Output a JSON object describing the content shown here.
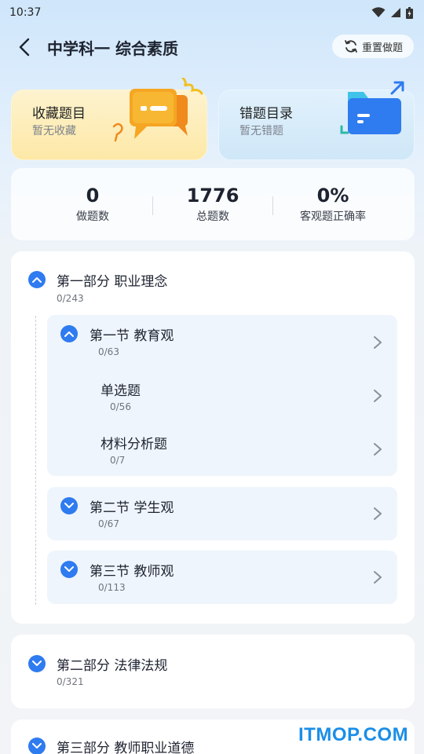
{
  "status_bar": {
    "time": "10:37"
  },
  "header": {
    "title": "中学科一 综合素质",
    "reset_label": "重置做题"
  },
  "cards": {
    "favorites": {
      "title": "收藏题目",
      "subtitle": "暂无收藏"
    },
    "wrong": {
      "title": "错题目录",
      "subtitle": "暂无错题"
    }
  },
  "stats": [
    {
      "value": "0",
      "label": "做题数"
    },
    {
      "value": "1776",
      "label": "总题数"
    },
    {
      "value": "0%",
      "label": "客观题正确率"
    }
  ],
  "parts": [
    {
      "title": "第一部分 职业理念",
      "count": "0/243",
      "expanded": true,
      "sections": [
        {
          "title": "第一节 教育观",
          "count": "0/63",
          "expanded": true,
          "subs": [
            {
              "title": "单选题",
              "count": "0/56"
            },
            {
              "title": "材料分析题",
              "count": "0/7"
            }
          ]
        },
        {
          "title": "第二节 学生观",
          "count": "0/67",
          "expanded": false
        },
        {
          "title": "第三节 教师观",
          "count": "0/113",
          "expanded": false
        }
      ]
    },
    {
      "title": "第二部分 法律法规",
      "count": "0/321",
      "expanded": false
    },
    {
      "title": "第三部分 教师职业道德",
      "expanded": false
    }
  ],
  "watermark": "ITMOP.COM",
  "colors": {
    "accent": "#2f7bf0",
    "fav_card": "#fde8a6",
    "wrong_card": "#cfe7f8",
    "watermark": "#1a8ee8"
  }
}
